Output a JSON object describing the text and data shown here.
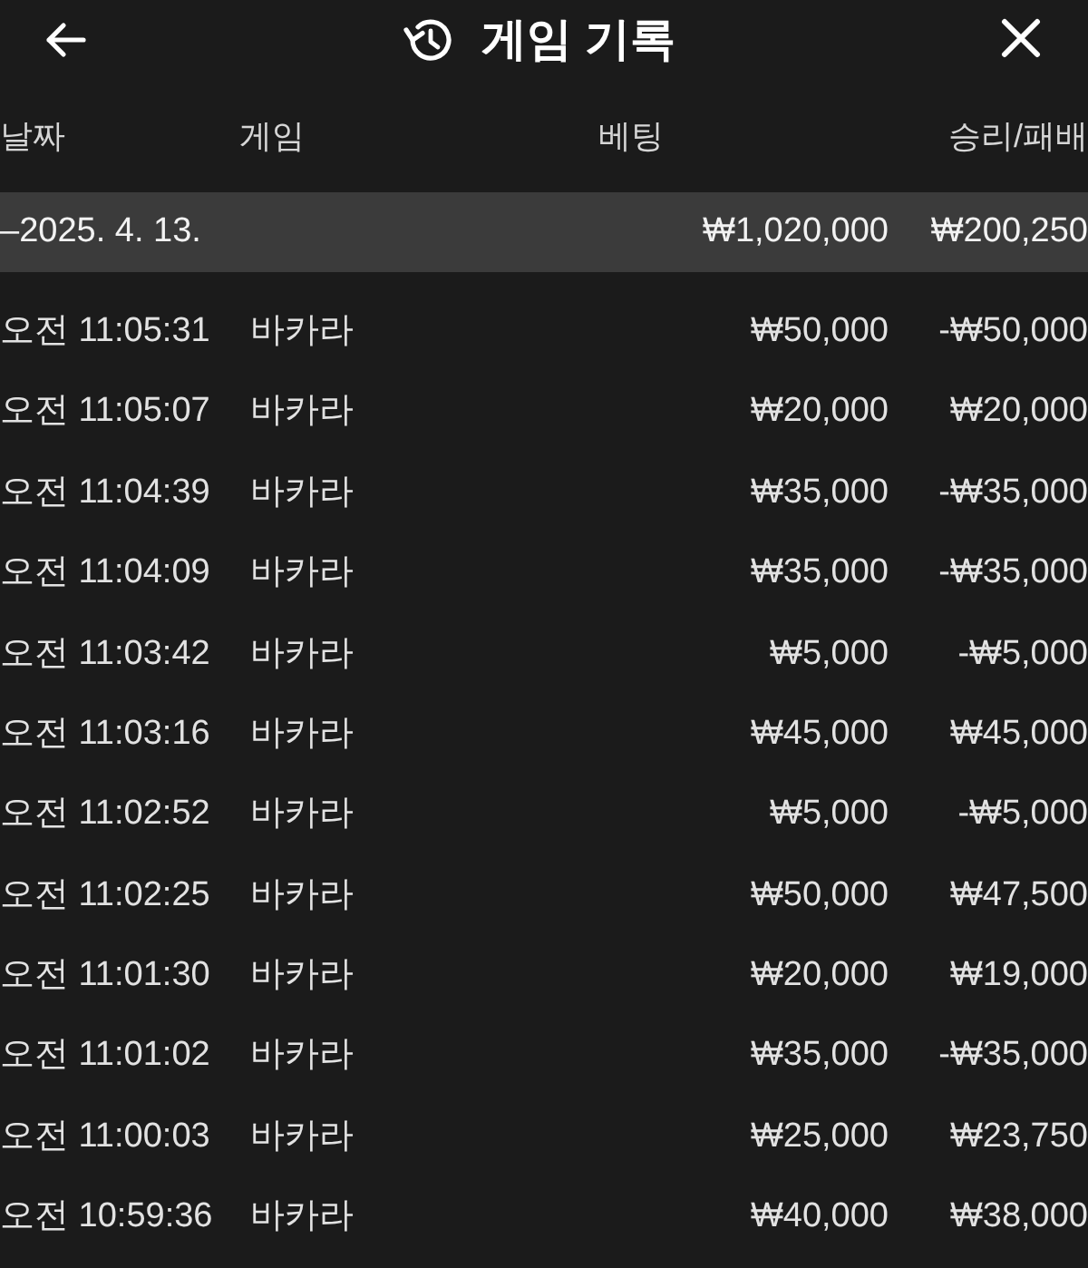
{
  "header": {
    "title": "게임 기록"
  },
  "columns": [
    "날짜",
    "게임",
    "베팅",
    "승리/패배"
  ],
  "groups": [
    {
      "date": "–2025. 4. 13.",
      "bet": "₩1,020,000",
      "result": "₩200,250",
      "rows": [
        {
          "time": "오전 11:05:31",
          "game": "바카라",
          "bet": "₩50,000",
          "result": "-₩50,000"
        },
        {
          "time": "오전 11:05:07",
          "game": "바카라",
          "bet": "₩20,000",
          "result": "₩20,000"
        },
        {
          "time": "오전 11:04:39",
          "game": "바카라",
          "bet": "₩35,000",
          "result": "-₩35,000"
        },
        {
          "time": "오전 11:04:09",
          "game": "바카라",
          "bet": "₩35,000",
          "result": "-₩35,000"
        },
        {
          "time": "오전 11:03:42",
          "game": "바카라",
          "bet": "₩5,000",
          "result": "-₩5,000"
        },
        {
          "time": "오전 11:03:16",
          "game": "바카라",
          "bet": "₩45,000",
          "result": "₩45,000"
        },
        {
          "time": "오전 11:02:52",
          "game": "바카라",
          "bet": "₩5,000",
          "result": "-₩5,000"
        },
        {
          "time": "오전 11:02:25",
          "game": "바카라",
          "bet": "₩50,000",
          "result": "₩47,500"
        },
        {
          "time": "오전 11:01:30",
          "game": "바카라",
          "bet": "₩20,000",
          "result": "₩19,000"
        },
        {
          "time": "오전 11:01:02",
          "game": "바카라",
          "bet": "₩35,000",
          "result": "-₩35,000"
        },
        {
          "time": "오전 11:00:03",
          "game": "바카라",
          "bet": "₩25,000",
          "result": "₩23,750"
        },
        {
          "time": "오전 10:59:36",
          "game": "바카라",
          "bet": "₩40,000",
          "result": "₩38,000"
        }
      ]
    }
  ]
}
